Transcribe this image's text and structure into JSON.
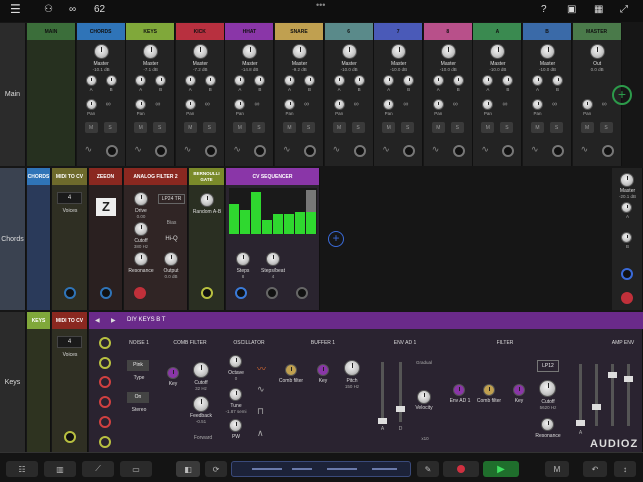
{
  "topbar": {
    "counter": "62"
  },
  "rows": {
    "main": "Main",
    "chords": "Chords",
    "keys": "Keys"
  },
  "main_strips": [
    {
      "name": "MAIN",
      "color": "#3b6e3a",
      "level": ""
    },
    {
      "name": "CHORDS",
      "color": "#2f74b8",
      "level": "-10.1 dB"
    },
    {
      "name": "KEYS",
      "color": "#80a83a",
      "level": "-7.1 dB"
    },
    {
      "name": "KICK",
      "color": "#b8303f",
      "level": "-7.2 dB"
    },
    {
      "name": "HHAT",
      "color": "#8a36a8",
      "level": "-14.8 dB"
    },
    {
      "name": "SNARE",
      "color": "#c0a050",
      "level": "-9.2 dB"
    },
    {
      "name": "6",
      "color": "#5a8a8a",
      "level": "-10.0 dB"
    },
    {
      "name": "7",
      "color": "#4a5ab8",
      "level": "-10.0 dB"
    },
    {
      "name": "8",
      "color": "#b8508a",
      "level": "-10.0 dB"
    },
    {
      "name": "A",
      "color": "#3a8a50",
      "level": "-10.0 dB"
    },
    {
      "name": "B",
      "color": "#3a6aa8",
      "level": "-10.0 dB"
    },
    {
      "name": "MASTER",
      "color": "#4a7a4a",
      "level": "0.0 dB"
    }
  ],
  "strip_labels": {
    "master": "Master",
    "out": "Out",
    "pan": "Pan",
    "a": "A",
    "b": "B",
    "m": "M",
    "s": "S"
  },
  "chords_row": {
    "header": "CHORDS",
    "midi_to_cv": {
      "title": "MIDI TO CV",
      "voices": "4",
      "voices_label": "Voices"
    },
    "zeeon": {
      "title": "ZEEON"
    },
    "analog_filter": {
      "title": "ANALOG FILTER 2",
      "drive": "Drive",
      "drive_val": "0.00",
      "mode": "LP24 TR",
      "bias": "Bias",
      "cutoff": "Cutoff",
      "cutoff_val": "380 Hz",
      "hiq": "Hi-Q",
      "resonance": "Resonance",
      "output": "Output",
      "output_val": "0.0 dB"
    },
    "bernoulli": {
      "title": "BERNOULLI GATE",
      "random": "Random A-B"
    },
    "cv_seq": {
      "title": "CV SEQUENCER",
      "steps": "Steps",
      "steps_val": "8",
      "per_beat": "Steps/beat",
      "per_beat_val": "4"
    },
    "master": {
      "label": "Master",
      "val": "-20.1 dB",
      "a": "A",
      "b": "B"
    }
  },
  "keys_row": {
    "header": "KEYS",
    "midi_to_cv": {
      "title": "MIDI TO CV",
      "voices": "4",
      "voices_label": "Voices"
    },
    "preset": "DIY KEYS B T",
    "noise": {
      "title": "NOISE 1",
      "color": "Pink",
      "type": "Type",
      "stereo_btn": "On",
      "stereo": "Stereo"
    },
    "comb": {
      "title": "COMB FILTER",
      "key": "Key",
      "cutoff": "Cutoff",
      "cutoff_val": "32 Hz",
      "feedback": "Feedback",
      "feedback_val": "-0.51",
      "mode": "Forward"
    },
    "osc": {
      "title": "OSCILLATOR",
      "octave": "Octave",
      "octave_val": "0",
      "tune": "Tune",
      "tune_val": "-1.87 semi",
      "pw": "PW"
    },
    "buffer": {
      "title": "BUFFER 1",
      "comb": "Comb filter",
      "key": "Key",
      "pitch": "Pitch",
      "pitch_val": "150 Hz"
    },
    "env": {
      "title": "ENV AD 1",
      "mode": "Gradual",
      "velocity": "Velocity",
      "a": "A",
      "d": "D",
      "mult": "x10"
    },
    "filter": {
      "title": "FILTER",
      "mode": "LP12",
      "env": "Env AD 1",
      "comb": "Comb filter",
      "key": "Key",
      "cutoff": "Cutoff",
      "cutoff_val": "5620 Hz",
      "resonance": "Resonance"
    },
    "amp": {
      "title": "AMP ENV",
      "a": "A"
    }
  },
  "watermark": "AUDIOZ"
}
